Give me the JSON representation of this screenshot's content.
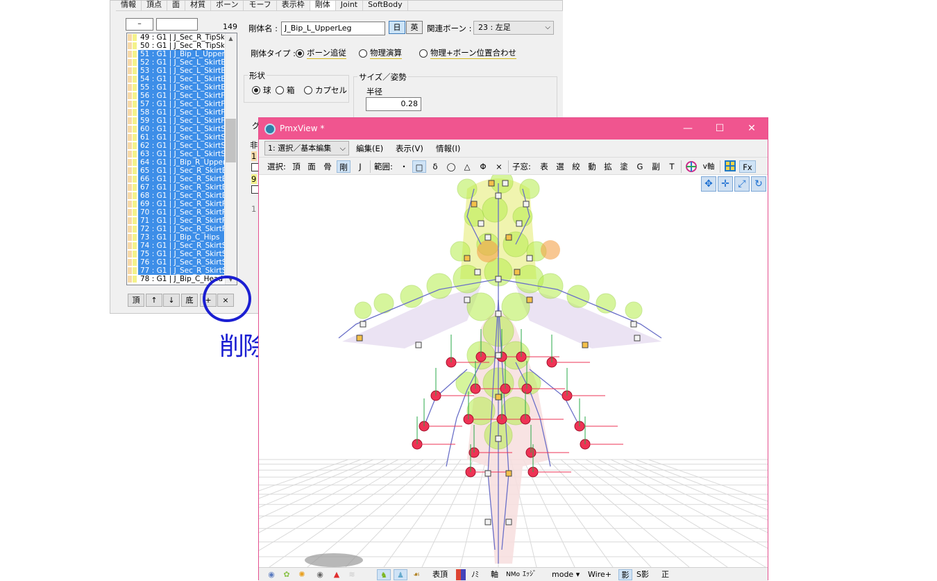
{
  "editor": {
    "tabs": [
      "情報",
      "頂点",
      "面",
      "材質",
      "ボーン",
      "モーフ",
      "表示枠",
      "剛体",
      "Joint",
      "SoftBody"
    ],
    "active_tab": "剛体",
    "list_filter_left": "–",
    "list_filter_right": "",
    "count": "149",
    "rows": [
      {
        "label": "49 : G1  |  J_Sec_R_TipSk",
        "selected": false
      },
      {
        "label": "50 : G1  |  J_Sec_R_TipSk",
        "selected": false
      },
      {
        "label": "51 : G1  |  J_Bip_L_Upper",
        "selected": true
      },
      {
        "label": "52 : G1  |  J_Sec_L_SkirtB",
        "selected": true
      },
      {
        "label": "53 : G1  |  J_Sec_L_SkirtB",
        "selected": true
      },
      {
        "label": "54 : G1  |  J_Sec_L_SkirtB",
        "selected": true
      },
      {
        "label": "55 : G1  |  J_Sec_L_SkirtB",
        "selected": true
      },
      {
        "label": "56 : G1  |  J_Sec_L_SkirtF",
        "selected": true
      },
      {
        "label": "57 : G1  |  J_Sec_L_SkirtF",
        "selected": true
      },
      {
        "label": "58 : G1  |  J_Sec_L_SkirtF",
        "selected": true
      },
      {
        "label": "59 : G1  |  J_Sec_L_SkirtF",
        "selected": true
      },
      {
        "label": "60 : G1  |  J_Sec_L_SkirtS",
        "selected": true
      },
      {
        "label": "61 : G1  |  J_Sec_L_SkirtS",
        "selected": true
      },
      {
        "label": "62 : G1  |  J_Sec_L_SkirtS",
        "selected": true
      },
      {
        "label": "63 : G1  |  J_Sec_L_SkirtS",
        "selected": true
      },
      {
        "label": "64 : G1  |  J_Bip_R_Upper",
        "selected": true
      },
      {
        "label": "65 : G1  |  J_Sec_R_SkirtB",
        "selected": true
      },
      {
        "label": "66 : G1  |  J_Sec_R_SkirtB",
        "selected": true
      },
      {
        "label": "67 : G1  |  J_Sec_R_SkirtB",
        "selected": true
      },
      {
        "label": "68 : G1  |  J_Sec_R_SkirtB",
        "selected": true
      },
      {
        "label": "69 : G1  |  J_Sec_R_SkirtF",
        "selected": true
      },
      {
        "label": "70 : G1  |  J_Sec_R_SkirtF",
        "selected": true
      },
      {
        "label": "71 : G1  |  J_Sec_R_SkirtF",
        "selected": true
      },
      {
        "label": "72 : G1  |  J_Sec_R_SkirtF",
        "selected": true
      },
      {
        "label": "73 : G1  |  J_Bip_C_Hips",
        "selected": true
      },
      {
        "label": "74 : G1  |  J_Sec_R_SkirtS",
        "selected": true
      },
      {
        "label": "75 : G1  |  J_Sec_R_SkirtS",
        "selected": true
      },
      {
        "label": "76 : G1  |  J_Sec_R_SkirtS",
        "selected": true
      },
      {
        "label": "77 : G1  |  J_Sec_R_SkirtS",
        "selected": true
      },
      {
        "label": "78 : G1  |  J_Bip_C_Head",
        "selected": false
      }
    ],
    "list_buttons": [
      "頂",
      "↑",
      "↓",
      "底",
      "+",
      "×"
    ],
    "name_label": "剛体名 :",
    "name_value": "J_Bip_L_UpperLeg",
    "lang_jp": "日",
    "lang_en": "英",
    "bone_label": "関連ボーン :",
    "bone_value": "23 : 左足",
    "type_label": "剛体タイプ :",
    "type_options": [
      "ボーン追従",
      "物理演算",
      "物理+ボーン位置合わせ"
    ],
    "shape_group": "形状",
    "shape_options": [
      "球",
      "箱",
      "カプセル"
    ],
    "size_group": "サイズ／姿勢",
    "radius_label": "半径",
    "radius_value": "0.28",
    "partial_labels": [
      "グ",
      "非",
      "1",
      "9",
      "1"
    ]
  },
  "annotation": {
    "note": "削除",
    "color": "#1b1fd2"
  },
  "viewer": {
    "title": "PmxView *",
    "minimize": "—",
    "maximize": "☐",
    "close": "✕",
    "mode": "1: 選択／基本編集",
    "menus": [
      "編集(E)",
      "表示(V)",
      "情報(I)"
    ],
    "toolbar_select": "選択:",
    "toolbar_targets": [
      "頂",
      "面",
      "骨",
      "剛",
      "J"
    ],
    "toolbar_range": "範囲:",
    "toolbar_range_items": [
      "・",
      "□",
      "δ",
      "◯",
      "△",
      "Φ",
      "×"
    ],
    "toolbar_child": "子窓:",
    "toolbar_windows": [
      "表",
      "選",
      "絞",
      "動",
      "拡",
      "塗",
      "G",
      "副",
      "T"
    ],
    "toolbar_vaxis": "v軸",
    "toolbar_fx": "Fx",
    "status_items": [
      "表頂",
      "ﾉﾐ",
      "軸",
      "NMo",
      "ｴｯｼﾞ",
      "mode ▾",
      "Wire+",
      "影",
      "S影",
      "正"
    ],
    "colors": {
      "titlebar": "#f0558f",
      "selection": "#3d8ee8",
      "rigid_sphere": "#b6ee4c",
      "joint_red": "#ee3355",
      "bone_blue": "#6a6fc8"
    }
  }
}
